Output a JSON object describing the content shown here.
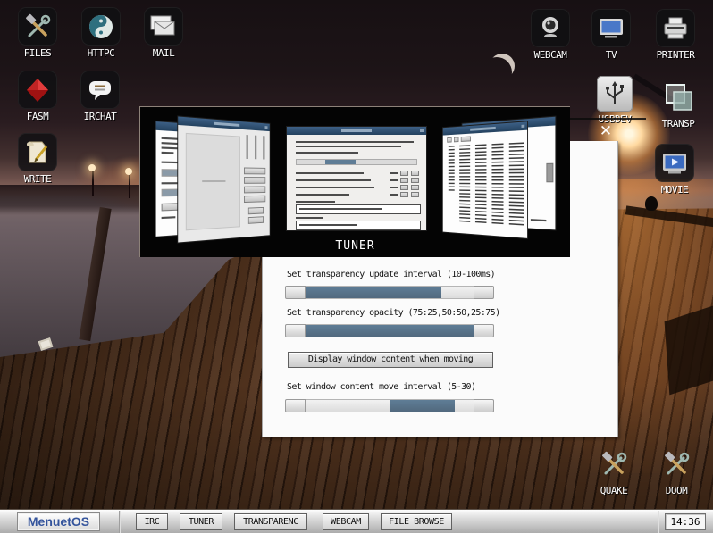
{
  "colors": {
    "titlebar_blue": "#2e4f73",
    "slider_fill": "#5f7d96",
    "menu_text_blue": "#34549c",
    "overlay_background": "#000000",
    "window_background": "#fbfbfb"
  },
  "desktop": {
    "icons": [
      {
        "label": "FILES",
        "icon": "tools-icon"
      },
      {
        "label": "HTTPC",
        "icon": "yinyang-icon"
      },
      {
        "label": "MAIL",
        "icon": "envelope-icon"
      },
      {
        "label": "FASM",
        "icon": "gem-icon"
      },
      {
        "label": "IRCHAT",
        "icon": "chat-bubble-icon"
      },
      {
        "label": "WRITE",
        "icon": "scroll-pen-icon"
      },
      {
        "label": "WEBCAM",
        "icon": "webcam-icon"
      },
      {
        "label": "TV",
        "icon": "tv-icon"
      },
      {
        "label": "PRINTER",
        "icon": "printer-icon"
      },
      {
        "label": "USBDEV",
        "icon": "usb-icon"
      },
      {
        "label": "TRANSP",
        "icon": "overlap-squares-icon"
      },
      {
        "label": "MOVIE",
        "icon": "play-screen-icon"
      },
      {
        "label": "QUAKE",
        "icon": "tools-icon"
      },
      {
        "label": "DOOM",
        "icon": "tools-icon"
      }
    ]
  },
  "switcher": {
    "selected_label": "TUNER"
  },
  "transparency_window": {
    "close_icon": "✕",
    "button_label": "Display window content when moving",
    "sliders": [
      {
        "name": "update-interval",
        "label": "Set transparency update interval (10-100ms)",
        "fill_left_pct": 0,
        "fill_width_pct": 81
      },
      {
        "name": "opacity",
        "label": "Set transparency opacity (75:25,50:50,25:75)",
        "fill_left_pct": 0,
        "fill_width_pct": 100
      },
      {
        "name": "move-interval",
        "label": "Set window content move interval (5-30)",
        "fill_left_pct": 50,
        "fill_width_pct": 39
      }
    ]
  },
  "taskbar": {
    "menu_label": "MenuetOS",
    "tasks": [
      "IRC",
      "TUNER",
      "TRANSPARENC",
      "WEBCAM",
      "FILE BROWSE"
    ],
    "clock": "14:36"
  }
}
